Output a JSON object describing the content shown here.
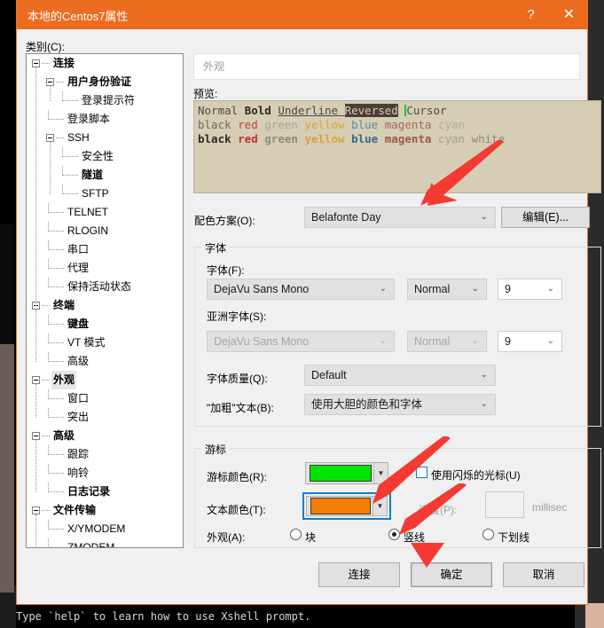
{
  "window": {
    "title": "本地的Centos7属性",
    "help_icon": "?",
    "close_icon": "✕",
    "accent_color": "#ec6c1f"
  },
  "background": {
    "terminal_line": "Type `help` to learn how to use Xshell prompt."
  },
  "category": {
    "label": "类别(C):",
    "nodes": [
      {
        "label": "连接",
        "depth": 0,
        "bold": true,
        "expander": true,
        "selected": false
      },
      {
        "label": "用户身份验证",
        "depth": 1,
        "bold": true,
        "expander": true,
        "selected": false
      },
      {
        "label": "登录提示符",
        "depth": 2,
        "bold": false,
        "expander": false,
        "selected": false
      },
      {
        "label": "登录脚本",
        "depth": 1,
        "bold": false,
        "expander": false,
        "selected": false
      },
      {
        "label": "SSH",
        "depth": 1,
        "bold": false,
        "expander": true,
        "selected": false
      },
      {
        "label": "安全性",
        "depth": 2,
        "bold": false,
        "expander": false,
        "selected": false
      },
      {
        "label": "隧道",
        "depth": 2,
        "bold": true,
        "expander": false,
        "selected": false
      },
      {
        "label": "SFTP",
        "depth": 2,
        "bold": false,
        "expander": false,
        "selected": false
      },
      {
        "label": "TELNET",
        "depth": 1,
        "bold": false,
        "expander": false,
        "selected": false
      },
      {
        "label": "RLOGIN",
        "depth": 1,
        "bold": false,
        "expander": false,
        "selected": false
      },
      {
        "label": "串口",
        "depth": 1,
        "bold": false,
        "expander": false,
        "selected": false
      },
      {
        "label": "代理",
        "depth": 1,
        "bold": false,
        "expander": false,
        "selected": false
      },
      {
        "label": "保持活动状态",
        "depth": 1,
        "bold": false,
        "expander": false,
        "selected": false
      },
      {
        "label": "终端",
        "depth": 0,
        "bold": true,
        "expander": true,
        "selected": false
      },
      {
        "label": "键盘",
        "depth": 1,
        "bold": true,
        "expander": false,
        "selected": false
      },
      {
        "label": "VT 模式",
        "depth": 1,
        "bold": false,
        "expander": false,
        "selected": false
      },
      {
        "label": "高级",
        "depth": 1,
        "bold": false,
        "expander": false,
        "selected": false
      },
      {
        "label": "外观",
        "depth": 0,
        "bold": true,
        "expander": true,
        "selected": true
      },
      {
        "label": "窗口",
        "depth": 1,
        "bold": false,
        "expander": false,
        "selected": false
      },
      {
        "label": "突出",
        "depth": 1,
        "bold": false,
        "expander": false,
        "selected": false
      },
      {
        "label": "高级",
        "depth": 0,
        "bold": true,
        "expander": true,
        "selected": false
      },
      {
        "label": "跟踪",
        "depth": 1,
        "bold": false,
        "expander": false,
        "selected": false
      },
      {
        "label": "响铃",
        "depth": 1,
        "bold": false,
        "expander": false,
        "selected": false
      },
      {
        "label": "日志记录",
        "depth": 1,
        "bold": true,
        "expander": false,
        "selected": false
      },
      {
        "label": "文件传输",
        "depth": 0,
        "bold": true,
        "expander": true,
        "selected": false
      },
      {
        "label": "X/YMODEM",
        "depth": 1,
        "bold": false,
        "expander": false,
        "selected": false
      },
      {
        "label": "ZMODEM",
        "depth": 1,
        "bold": false,
        "expander": false,
        "selected": false
      }
    ]
  },
  "pane": {
    "header": "外观",
    "preview_label": "预览:",
    "preview": {
      "bg_color": "#d5cdb4",
      "line1": [
        {
          "text": "Normal ",
          "color": "#4a4a42",
          "style": "normal"
        },
        {
          "text": "Bold ",
          "color": "#2a2a22",
          "style": "bold"
        },
        {
          "text": "Underline ",
          "color": "#4a4a42",
          "style": "underline"
        },
        {
          "text": "Reversed",
          "color": "#d5cdb4",
          "style": "reversed"
        },
        {
          "text": " ",
          "color": "#4a4a42",
          "style": "normal"
        },
        {
          "text": "Cursor",
          "color": "#4a4a42",
          "style": "cursor-before"
        }
      ],
      "line2": [
        {
          "text": "black ",
          "color": "#6f6a5e"
        },
        {
          "text": "red ",
          "color": "#d13a33"
        },
        {
          "text": "green ",
          "color": "#a8a498"
        },
        {
          "text": "yellow ",
          "color": "#dfa33c"
        },
        {
          "text": "blue ",
          "color": "#5d86a8"
        },
        {
          "text": "magenta ",
          "color": "#a36a5c"
        },
        {
          "text": "cyan",
          "color": "#b0aca0"
        }
      ],
      "line3": [
        {
          "text": "black ",
          "color": "#2c2c24",
          "bold": true
        },
        {
          "text": "red ",
          "color": "#c0332c",
          "bold": true
        },
        {
          "text": "green ",
          "color": "#8f8b80",
          "bold": true
        },
        {
          "text": "yellow ",
          "color": "#e0a13a",
          "bold": true
        },
        {
          "text": "blue ",
          "color": "#35698f",
          "bold": true
        },
        {
          "text": "magenta ",
          "color": "#9c5a47",
          "bold": true
        },
        {
          "text": "cyan ",
          "color": "#a5a195",
          "bold": false
        },
        {
          "text": "white",
          "color": "#8d8a7e",
          "bold": false
        }
      ]
    },
    "scheme": {
      "label": "配色方案(O):",
      "value": "Belafonte Day",
      "edit_button": "编辑(E)..."
    },
    "font_group": {
      "title": "字体",
      "font_label": "字体(F):",
      "font_value": "DejaVu Sans Mono",
      "font_style": "Normal",
      "font_size": "9",
      "asian_label": "亚洲字体(S):",
      "asian_value": "DejaVu Sans Mono",
      "asian_style": "Normal",
      "asian_size": "9",
      "quality_label": "字体质量(Q):",
      "quality_value": "Default",
      "bold_label": "\"加粗\"文本(B):",
      "bold_value": "使用大胆的颜色和字体"
    },
    "cursor_group": {
      "title": "游标",
      "cursor_color_label": "游标颜色(R):",
      "cursor_color": "#00e300",
      "text_color_label": "文本颜色(T):",
      "text_color": "#f57e00",
      "blink_label": "使用闪烁的光标(U)",
      "blink_checked": false,
      "speed_label": "速度(P):",
      "speed_value": "",
      "speed_unit": "millisec",
      "appearance_label": "外观(A):",
      "options": [
        {
          "label": "块",
          "selected": false
        },
        {
          "label": "竖线",
          "selected": true
        },
        {
          "label": "下划线",
          "selected": false
        }
      ]
    }
  },
  "footer": {
    "connect": "连接",
    "ok": "确定",
    "cancel": "取消"
  },
  "annotations": {
    "arrow_color": "#f43a33",
    "count": 3
  }
}
